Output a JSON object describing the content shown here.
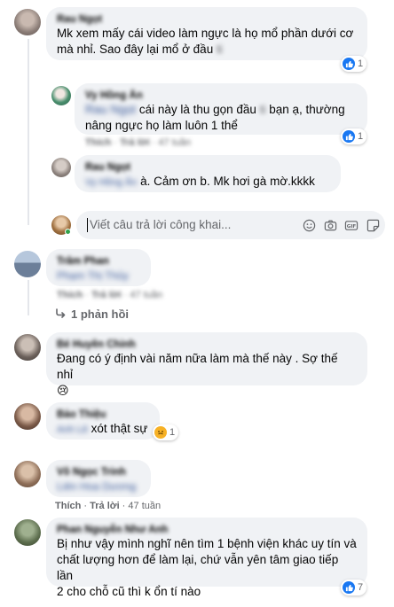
{
  "comments": [
    {
      "author": "Rau Ngọt",
      "text_lines": [
        "Mk xem mấy cái video làm ngực là họ mổ phần dưới cơ",
        "mà nhỉ. Sao đây lại mổ ở đầu"
      ],
      "text_blurred_tail": "ti",
      "reactions": "1"
    },
    {
      "author": "Vy Hồng Ân",
      "mention": "Rau Ngọt",
      "text_lines": [
        "cái này là thu gọn đầu",
        "bạn ạ, thường",
        "nâng ngực họ làm luôn 1 thể"
      ],
      "text_blurred_mid": "ti",
      "meta": {
        "like": "Thích",
        "reply": "Trả lời",
        "time": "47 tuần"
      },
      "reactions": "1"
    },
    {
      "author": "Rau Ngọt",
      "mention": "Vy Hồng Ân",
      "text": "à. Cảm ơn b. Mk hơi gà mờ.kkkk"
    },
    {
      "author": "Trâm Phan",
      "text": "Phạm Thị Thủy",
      "meta": {
        "like": "Thích",
        "reply": "Trả lời",
        "time": "47 tuần"
      }
    },
    {
      "author": "Bé Huyền Chinh",
      "text_lines": [
        "Đang có ý định vài năm nữa làm mà thế này . Sợ thế nhỉ"
      ],
      "emoji": "😢"
    },
    {
      "author": "Bảo Thiệu",
      "mention": "Anh Lê",
      "text": "xót thật sự",
      "reactions": "1"
    },
    {
      "author": "Võ Ngọc Trinh",
      "text": "Liên Hoa Dương",
      "meta": {
        "like": "Thích",
        "reply": "Trả lời",
        "time": "47 tuần"
      }
    },
    {
      "author": "Phan Nguyễn Như Anh",
      "text_lines": [
        "Bị như vậy mình nghĩ nên tìm 1 bệnh viện khác uy tín và",
        "chất lượng hơn để làm lại, chứ vẫn yên tâm giao tiếp lần",
        "2 cho chỗ cũ thì k ổn tí nào"
      ],
      "reactions": "7"
    }
  ],
  "reply_box": {
    "placeholder": "Viết câu trả lời công khai..."
  },
  "view_replies": "1 phản hồi",
  "icons": [
    "like-icon",
    "haha-icon",
    "emoji-icon",
    "camera-icon",
    "gif-icon",
    "sticker-icon",
    "reply-arrow-icon"
  ],
  "colors": {
    "bubble": "#f0f2f5",
    "like_blue": "#1877f2",
    "meta_gray": "#65676b"
  }
}
